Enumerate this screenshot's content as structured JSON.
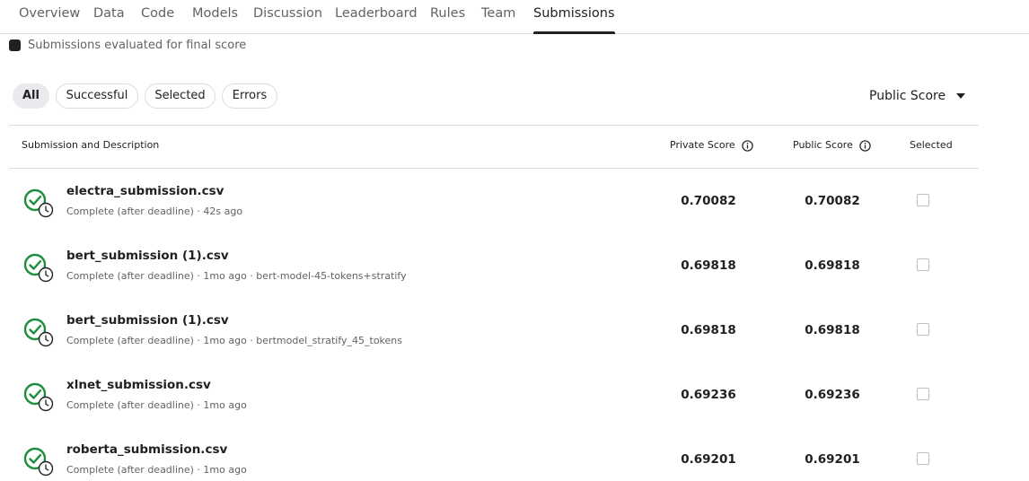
{
  "tabs": [
    "Overview",
    "Data",
    "Code",
    "Models",
    "Discussion",
    "Leaderboard",
    "Rules",
    "Team",
    "Submissions"
  ],
  "active_tab": "Submissions",
  "legend": {
    "label": "Submissions evaluated for final score"
  },
  "filters": [
    "All",
    "Successful",
    "Selected",
    "Errors"
  ],
  "active_filter": "All",
  "sort": {
    "label": "Public Score"
  },
  "columns": {
    "submission": "Submission and Description",
    "private": "Private Score",
    "public": "Public Score",
    "selected": "Selected"
  },
  "rows": [
    {
      "name": "electra_submission.csv",
      "meta": "Complete (after deadline) · 42s ago",
      "private": "0.70082",
      "public": "0.70082"
    },
    {
      "name": "bert_submission (1).csv",
      "meta": "Complete (after deadline) · 1mo ago · bert-model-45-tokens+stratify",
      "private": "0.69818",
      "public": "0.69818"
    },
    {
      "name": "bert_submission (1).csv",
      "meta": "Complete (after deadline) · 1mo ago · bertmodel_stratify_45_tokens",
      "private": "0.69818",
      "public": "0.69818"
    },
    {
      "name": "xlnet_submission.csv",
      "meta": "Complete (after deadline) · 1mo ago",
      "private": "0.69236",
      "public": "0.69236"
    },
    {
      "name": "roberta_submission.csv",
      "meta": "Complete (after deadline) · 1mo ago",
      "private": "0.69201",
      "public": "0.69201"
    }
  ],
  "colors": {
    "success_green": "#1e8e3e",
    "text_primary": "#202124",
    "text_secondary": "#5f6368",
    "divider": "#dadce0"
  }
}
